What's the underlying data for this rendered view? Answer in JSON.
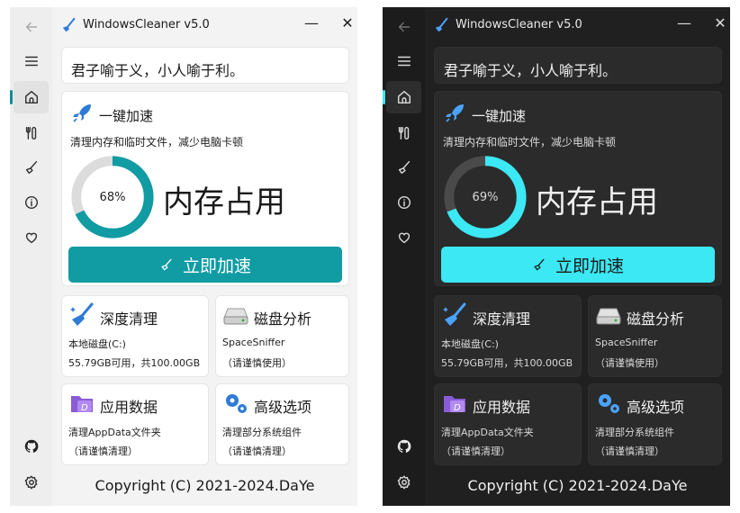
{
  "app": {
    "title": "WindowsCleaner v5.0"
  },
  "window_controls": {
    "minimize": "—",
    "close": "✕"
  },
  "sidebar": {
    "items": [
      {
        "name": "back",
        "icon": "arrow-left-icon"
      },
      {
        "name": "menu",
        "icon": "hamburger-icon"
      },
      {
        "name": "home",
        "icon": "home-icon",
        "active": true
      },
      {
        "name": "tools",
        "icon": "tools-icon"
      },
      {
        "name": "clean",
        "icon": "broom-icon"
      },
      {
        "name": "info",
        "icon": "info-icon"
      },
      {
        "name": "favorite",
        "icon": "heart-icon"
      },
      {
        "name": "github",
        "icon": "github-icon"
      },
      {
        "name": "settings",
        "icon": "gear-icon"
      }
    ]
  },
  "quote": "君子喻于义，小人喻于利。",
  "speedup": {
    "title": "一键加速",
    "subtitle": "清理内存和临时文件，减少电脑卡顿",
    "memory_label": "内存占用",
    "button_label": "立即加速"
  },
  "tools": {
    "deep_clean": {
      "title": "深度清理",
      "line1": "本地磁盘(C:)",
      "line2": "55.79GB可用，共100.00GB"
    },
    "disk_analysis": {
      "title": "磁盘分析",
      "line1": "SpaceSniffer",
      "line2": "（请谨慎使用）"
    },
    "app_data": {
      "title": "应用数据",
      "line1": "清理AppData文件夹",
      "line2": "（请谨慎清理）"
    },
    "advanced": {
      "title": "高级选项",
      "line1": "清理部分系统组件",
      "line2": "（请谨慎清理）"
    }
  },
  "copyright": "Copyright (C) 2021-2024.DaYe",
  "themes": [
    {
      "name": "light",
      "memory_percent": 68,
      "memory_text": "68%",
      "accent": "#119ba3",
      "track": "#dcdcdc"
    },
    {
      "name": "dark",
      "memory_percent": 69,
      "memory_text": "69%",
      "accent": "#3be8f3",
      "track": "#4a4a4a"
    }
  ]
}
